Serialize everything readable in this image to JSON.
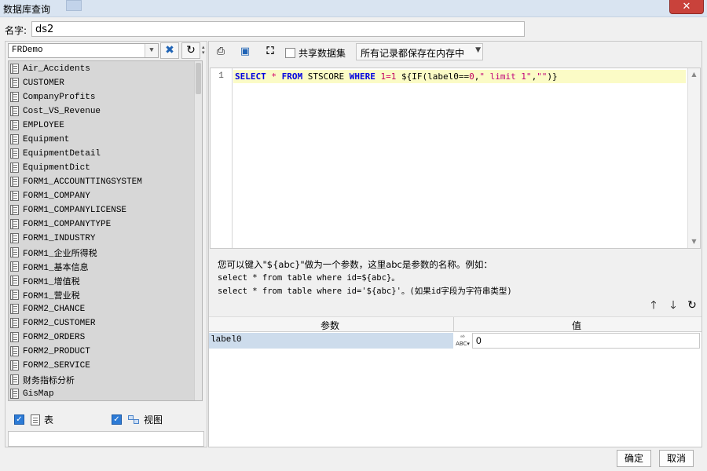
{
  "window": {
    "title": "数据库查询",
    "close_glyph": "✕"
  },
  "name_field": {
    "label": "名字:",
    "value": "ds2"
  },
  "left": {
    "db_select": "FRDemo",
    "tables": [
      "Air_Accidents",
      "CUSTOMER",
      "CompanyProfits",
      "Cost_VS_Revenue",
      "EMPLOYEE",
      "Equipment",
      "EquipmentDetail",
      "EquipmentDict",
      "FORM1_ACCOUNTTINGSYSTEM",
      "FORM1_COMPANY",
      "FORM1_COMPANYLICENSE",
      "FORM1_COMPANYTYPE",
      "FORM1_INDUSTRY",
      "FORM1_企业所得税",
      "FORM1_基本信息",
      "FORM1_增值税",
      "FORM1_营业税",
      "FORM2_CHANCE",
      "FORM2_CUSTOMER",
      "FORM2_ORDERS",
      "FORM2_PRODUCT",
      "FORM2_SERVICE",
      "财务指标分析",
      "GisMap"
    ],
    "check_table": "表",
    "check_view": "视图"
  },
  "toolbar": {
    "share_label": "共享数据集",
    "memory_select": "所有记录都保存在内存中"
  },
  "editor": {
    "line_no": "1",
    "tokens": {
      "select": "SELECT",
      "star": "*",
      "from": "FROM",
      "table": "STSCORE",
      "where": "WHERE",
      "cond_lhs": "1",
      "cond_eq": "=",
      "cond_rhs": "1",
      "expr_open": "${IF(label0==",
      "zero": "0",
      "comma1": ",",
      "str1": "\" limit 1\"",
      "comma2": ",",
      "str2": "\"\"",
      "expr_close": ")}"
    }
  },
  "hint": {
    "line1": "您可以键入\"${abc}\"做为一个参数，这里abc是参数的名称。例如：",
    "line2": "select * from table where id=${abc}。",
    "line3": "select * from table where id='${abc}'。(如果id字段为字符串类型)"
  },
  "params": {
    "col_name": "参数",
    "col_value": "值",
    "rows": [
      {
        "name": "label0",
        "type": "ABC",
        "value": "0"
      }
    ]
  },
  "buttons": {
    "ok": "确定",
    "cancel": "取消"
  }
}
